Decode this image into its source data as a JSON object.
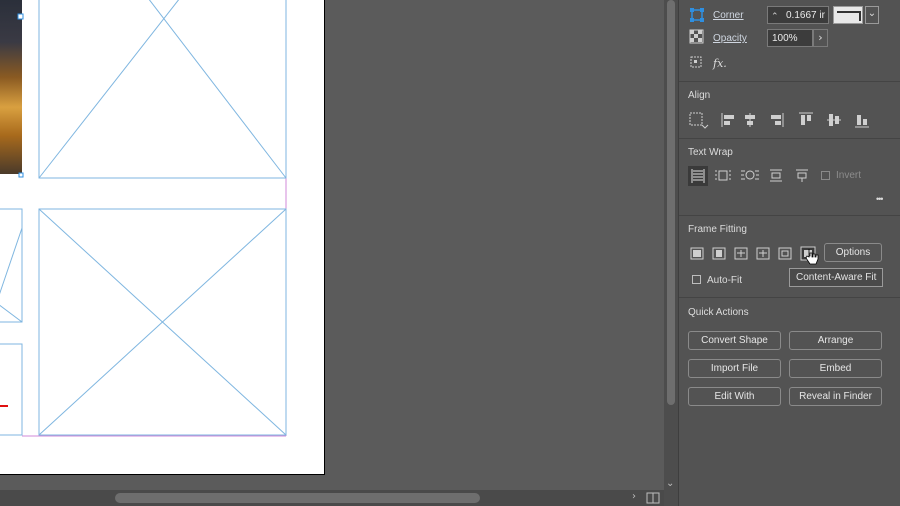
{
  "panel": {
    "corner_label": "Corner",
    "corner_value": "0.1667 ir",
    "opacity_label": "Opacity",
    "opacity_value": "100%",
    "fx_label": "fx.",
    "align_title": "Align",
    "text_wrap_title": "Text Wrap",
    "invert_label": "Invert",
    "more_label": "•••",
    "frame_fitting_title": "Frame Fitting",
    "options_label": "Options",
    "auto_fit_label": "Auto-Fit",
    "tooltip": "Content-Aware Fit",
    "quick_actions_title": "Quick Actions",
    "quick_actions": [
      "Convert Shape",
      "Arrange",
      "Import File",
      "Embed",
      "Edit With",
      "Reveal in Finder"
    ]
  },
  "colors": {
    "frame_guide": "#7fb6e0",
    "margin_guide": "#d08ad8",
    "accent_icon": "#2f8fe0"
  }
}
